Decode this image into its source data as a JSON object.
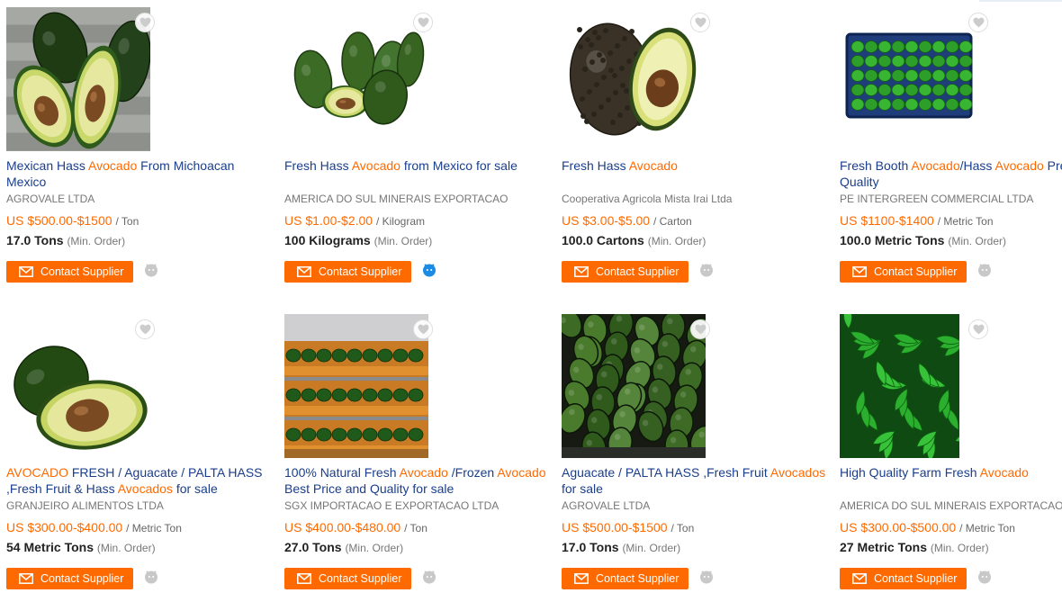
{
  "icons": {
    "favorite": "heart-icon",
    "mail": "mail-icon",
    "chat": "chat-icon"
  },
  "colors": {
    "accent": "#ff6a00",
    "title": "#1a3e8c",
    "chat_online": "#1c8be6",
    "chat_offline": "#c8c8c8"
  },
  "button_label": "Contact Supplier",
  "min_order_label": "(Min. Order)",
  "products": [
    {
      "title_parts": [
        {
          "t": "Mexican Hass ",
          "h": false
        },
        {
          "t": "Avocado",
          "h": true
        },
        {
          "t": " From Michoacan Mexico",
          "h": false
        }
      ],
      "supplier": "AGROVALE LTDA",
      "price": "US $500.00-$1500",
      "unit": "/ Ton",
      "moq": "17.0 Tons",
      "chat_online": false,
      "image": "halves-wood"
    },
    {
      "title_parts": [
        {
          "t": "Fresh Hass ",
          "h": false
        },
        {
          "t": "Avocado",
          "h": true
        },
        {
          "t": " from Mexico for sale",
          "h": false
        }
      ],
      "supplier": "AMERICA DO SUL MINERAIS EXPORTACAO",
      "price": "US $1.00-$2.00",
      "unit": "/ Kilogram",
      "moq": "100 Kilograms",
      "chat_online": true,
      "image": "group-white"
    },
    {
      "title_parts": [
        {
          "t": "Fresh Hass ",
          "h": false
        },
        {
          "t": "Avocado",
          "h": true
        }
      ],
      "supplier": "Cooperativa Agricola Mista Irai Ltda",
      "price": "US $3.00-$5.00",
      "unit": "/ Carton",
      "moq": "100.0 Cartons",
      "chat_online": false,
      "image": "hass-half"
    },
    {
      "title_parts": [
        {
          "t": "Fresh Booth ",
          "h": false
        },
        {
          "t": "Avocado",
          "h": true
        },
        {
          "t": "/Hass ",
          "h": false
        },
        {
          "t": "Avocado",
          "h": true
        },
        {
          "t": " Premium Quality",
          "h": false
        }
      ],
      "supplier": "PE INTERGREEN COMMERCIAL LTDA",
      "price": "US $1100-$1400",
      "unit": "/ Metric Ton",
      "moq": "100.0 Metric Tons",
      "chat_online": false,
      "image": "crate"
    },
    {
      "title_parts": [
        {
          "t": "AVOCADO",
          "h": true
        },
        {
          "t": " FRESH / Aguacate / PALTA HASS ,Fresh Fruit & Hass ",
          "h": false
        },
        {
          "t": "Avocados",
          "h": true
        },
        {
          "t": " for sale",
          "h": false
        }
      ],
      "supplier": "GRANJEIRO ALIMENTOS LTDA",
      "price": "US $300.00-$400.00",
      "unit": "/ Metric Ton",
      "moq": "54 Metric Tons",
      "chat_online": false,
      "image": "half-white"
    },
    {
      "title_parts": [
        {
          "t": "100% Natural Fresh ",
          "h": false
        },
        {
          "t": "Avocado",
          "h": true
        },
        {
          "t": " /Frozen ",
          "h": false
        },
        {
          "t": "Avocado",
          "h": true
        },
        {
          "t": " Best Price and Quality for sale",
          "h": false
        }
      ],
      "supplier": "SGX IMPORTACAO E EXPORTACAO LTDA",
      "price": "US $400.00-$480.00",
      "unit": "/ Ton",
      "moq": "27.0 Tons",
      "chat_online": false,
      "image": "boxes"
    },
    {
      "title_parts": [
        {
          "t": "Aguacate / PALTA HASS ,Fresh Fruit ",
          "h": false
        },
        {
          "t": "Avocados",
          "h": true
        },
        {
          "t": " for sale",
          "h": false
        }
      ],
      "supplier": "AGROVALE LTDA",
      "price": "US $500.00-$1500",
      "unit": "/ Ton",
      "moq": "17.0 Tons",
      "chat_online": false,
      "image": "pile-dark"
    },
    {
      "title_parts": [
        {
          "t": "High Quality Farm Fresh ",
          "h": false
        },
        {
          "t": "Avocado",
          "h": true
        }
      ],
      "supplier": "AMERICA DO SUL MINERAIS EXPORTACAO",
      "price": "US $300.00-$500.00",
      "unit": "/ Metric Ton",
      "moq": "27 Metric Tons",
      "chat_online": false,
      "image": "peppers"
    }
  ]
}
